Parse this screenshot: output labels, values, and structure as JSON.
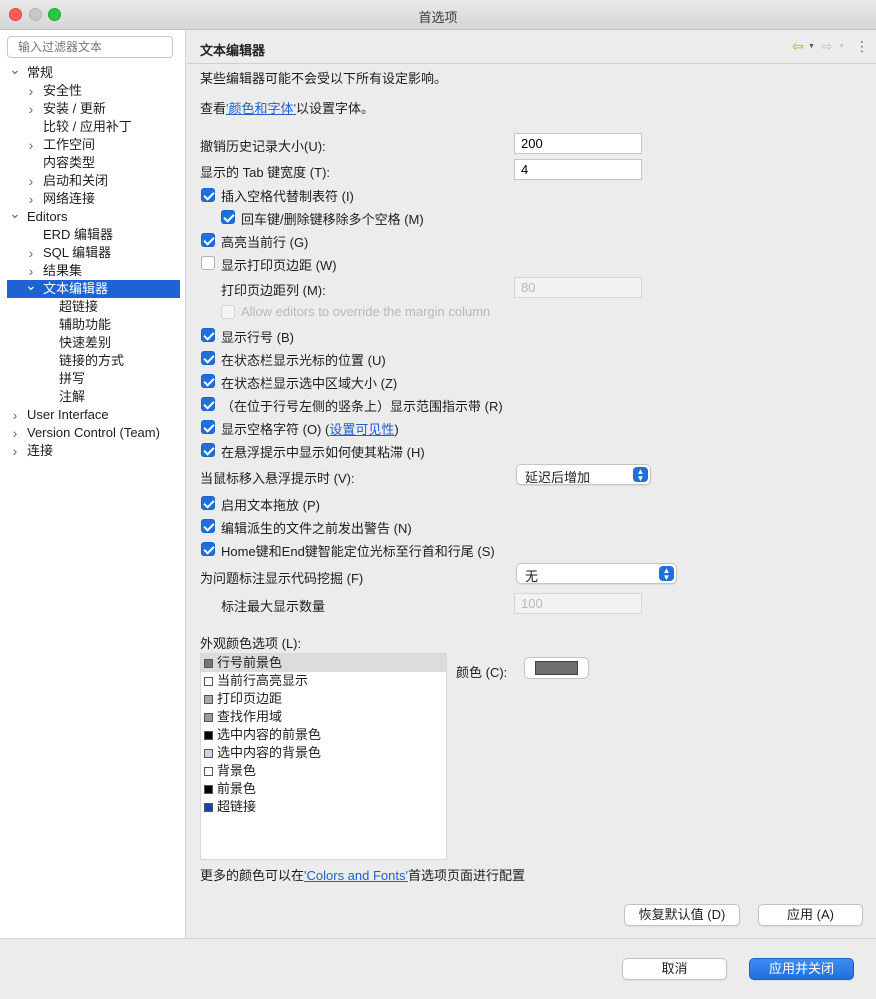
{
  "window": {
    "title": "首选项"
  },
  "sidebar": {
    "filter_placeholder": "输入过滤器文本",
    "tree": [
      {
        "label": "常规",
        "level": 0,
        "arrow": "expanded"
      },
      {
        "label": "安全性",
        "level": 1,
        "arrow": "collapsed"
      },
      {
        "label": "安装 / 更新",
        "level": 1,
        "arrow": "collapsed"
      },
      {
        "label": "比较 / 应用补丁",
        "level": 1,
        "arrow": "none"
      },
      {
        "label": "工作空间",
        "level": 1,
        "arrow": "collapsed"
      },
      {
        "label": "内容类型",
        "level": 1,
        "arrow": "none"
      },
      {
        "label": "启动和关闭",
        "level": 1,
        "arrow": "collapsed"
      },
      {
        "label": "网络连接",
        "level": 1,
        "arrow": "collapsed"
      },
      {
        "label": "Editors",
        "level": 0,
        "arrow": "expanded"
      },
      {
        "label": "ERD 编辑器",
        "level": 1,
        "arrow": "none"
      },
      {
        "label": "SQL 编辑器",
        "level": 1,
        "arrow": "collapsed"
      },
      {
        "label": "结果集",
        "level": 1,
        "arrow": "collapsed"
      },
      {
        "label": "文本编辑器",
        "level": 1,
        "arrow": "expanded",
        "selected": true
      },
      {
        "label": "超链接",
        "level": 2,
        "arrow": "none"
      },
      {
        "label": "辅助功能",
        "level": 2,
        "arrow": "none"
      },
      {
        "label": "快速差别",
        "level": 2,
        "arrow": "none"
      },
      {
        "label": "链接的方式",
        "level": 2,
        "arrow": "none"
      },
      {
        "label": "拼写",
        "level": 2,
        "arrow": "none"
      },
      {
        "label": "注解",
        "level": 2,
        "arrow": "none"
      },
      {
        "label": "User Interface",
        "level": 0,
        "arrow": "collapsed"
      },
      {
        "label": "Version Control (Team)",
        "level": 0,
        "arrow": "collapsed"
      },
      {
        "label": "连接",
        "level": 0,
        "arrow": "collapsed"
      }
    ]
  },
  "page": {
    "title": "文本编辑器",
    "intro": "某些编辑器可能不会受以下所有设定影响。",
    "font_prefix": "查看",
    "font_link": "'颜色和字体'",
    "font_suffix": "以设置字体。",
    "undo_label": "撤销历史记录大小(U):",
    "undo_value": "200",
    "tab_label": "显示的 Tab 键宽度 (T):",
    "tab_value": "4",
    "insert_spaces": "插入空格代替制表符 (I)",
    "backspace_spaces": "回车键/删除键移除多个空格 (M)",
    "highlight_line": "高亮当前行 (G)",
    "show_margin": "显示打印页边距 (W)",
    "margin_col_label": "打印页边距列 (M):",
    "margin_col_value": "80",
    "allow_override": "Allow editors to override the margin column",
    "show_line_numbers": "显示行号 (B)",
    "status_cursor": "在状态栏显示光标的位置 (U)",
    "status_selection": "在状态栏显示选中区域大小 (Z)",
    "range_indicator": "（在位于行号左侧的竖条上）显示范围指示带 (R)",
    "show_whitespace": "显示空格字符 (O)",
    "whitespace_paren_open": "(",
    "whitespace_link": "设置可见性",
    "whitespace_paren_close": ")",
    "hover_sticky": "在悬浮提示中显示如何使其粘滞 (H)",
    "hover_label": "当鼠标移入悬浮提示时 (V):",
    "hover_value": "延迟后增加",
    "drag_drop": "启用文本拖放 (P)",
    "warn_derived": "编辑派生的文件之前发出警告 (N)",
    "smart_home_end": "Home键和End键智能定位光标至行首和行尾 (S)",
    "code_mining_label": "为问题标注显示代码挖掘 (F)",
    "code_mining_value": "无",
    "max_annot_label": "标注最大显示数量",
    "max_annot_value": "100",
    "appearance_label": "外观颜色选项 (L):",
    "color_label": "颜色 (C):",
    "more_colors_prefix": "更多的颜色可以在",
    "more_colors_link": "'Colors and Fonts'",
    "more_colors_suffix": "首选项页面进行配置",
    "restore_defaults": "恢复默认值 (D)",
    "apply": "应用 (A)"
  },
  "color_options": [
    {
      "label": "行号前景色",
      "swatch": "#777777",
      "selected": true
    },
    {
      "label": "当前行高亮显示",
      "swatch": "#ffffff"
    },
    {
      "label": "打印页边距",
      "swatch": "#aaaaaa"
    },
    {
      "label": "查找作用域",
      "swatch": "#999999"
    },
    {
      "label": "选中内容的前景色",
      "swatch": "#000000"
    },
    {
      "label": "选中内容的背景色",
      "swatch": "#c6d4e6"
    },
    {
      "label": "背景色",
      "swatch": "#ffffff"
    },
    {
      "label": "前景色",
      "swatch": "#000000"
    },
    {
      "label": "超链接",
      "swatch": "#1a3fb8"
    }
  ],
  "colors": {
    "selected_swatch": "#707070",
    "accent": "#1f6fde"
  },
  "footer": {
    "cancel": "取消",
    "apply_close": "应用并关闭"
  }
}
